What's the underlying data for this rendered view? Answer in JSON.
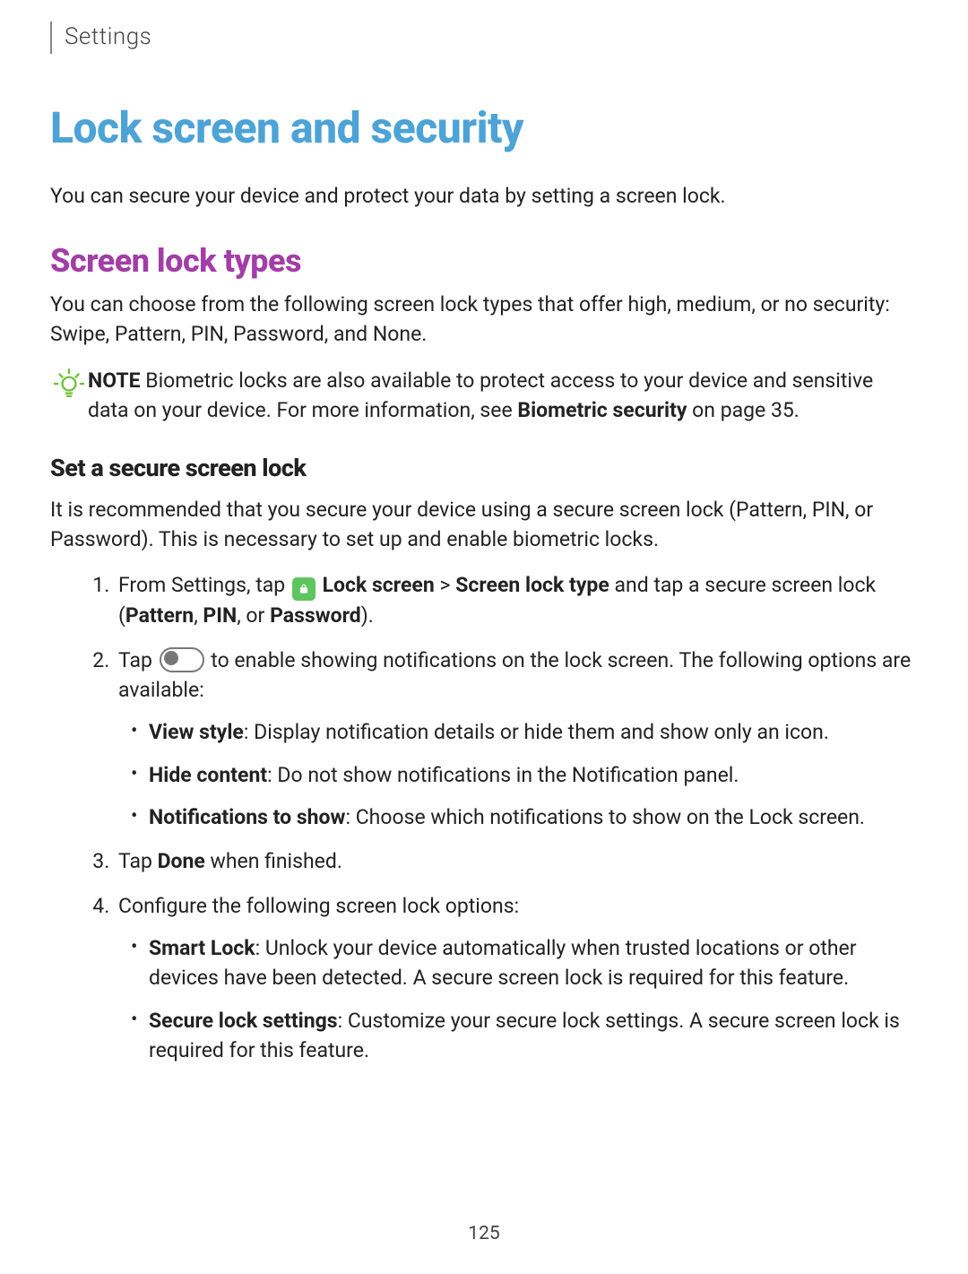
{
  "breadcrumb": "Settings",
  "title": "Lock screen and security",
  "intro": "You can secure your device and protect your data by setting a screen lock.",
  "section_title": "Screen lock types",
  "section_desc": "You can choose from the following screen lock types that offer high, medium, or no security: Swipe, Pattern, PIN, Password, and None.",
  "note": {
    "label": "NOTE",
    "part1": "  Biometric locks are also available to protect access to your device and sensitive data on your device. For more information, see ",
    "link": "Biometric security",
    "part2": " on page 35."
  },
  "sub_title": "Set a secure screen lock",
  "sub_desc": "It is recommended that you secure your device using a secure screen lock (Pattern, PIN, or Password). This is necessary to set up and enable biometric locks.",
  "steps": {
    "s1": {
      "a": "From Settings, tap ",
      "b": " Lock screen",
      "c": " > ",
      "d": "Screen lock type",
      "e": " and tap a secure screen lock (",
      "f": "Pattern",
      "g": ", ",
      "h": "PIN",
      "i": ", or ",
      "j": "Password",
      "k": ")."
    },
    "s2": {
      "a": "Tap ",
      "b": " to enable showing notifications on the lock screen. The following options are available:"
    },
    "s2_options": [
      {
        "label": "View style",
        "desc": ": Display notification details or hide them and show only an icon."
      },
      {
        "label": "Hide content",
        "desc": ": Do not show notifications in the Notification panel."
      },
      {
        "label": "Notifications to show",
        "desc": ": Choose which notifications to show on the Lock screen."
      }
    ],
    "s3": {
      "a": "Tap ",
      "b": "Done",
      "c": " when finished."
    },
    "s4": {
      "a": "Configure the following screen lock options:"
    },
    "s4_options": [
      {
        "label": "Smart Lock",
        "desc": ": Unlock your device automatically when trusted locations or other devices have been detected. A secure screen lock is required for this feature."
      },
      {
        "label": "Secure lock settings",
        "desc": ": Customize your secure lock settings. A secure screen lock is required for this feature."
      }
    ]
  },
  "page_number": "125"
}
